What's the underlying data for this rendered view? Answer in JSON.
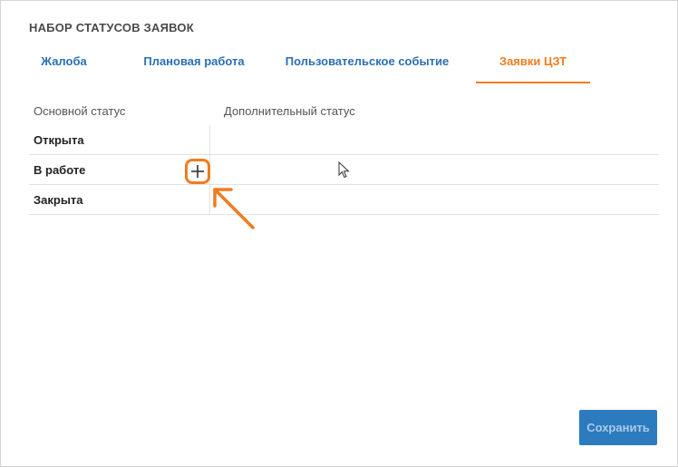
{
  "dialog": {
    "title": "НАБОР СТАТУСОВ ЗАЯВОК"
  },
  "tabs": [
    {
      "label": "Жалоба",
      "active": false
    },
    {
      "label": "Плановая работа",
      "active": false
    },
    {
      "label": "Пользовательское событие",
      "active": false
    },
    {
      "label": "Заявки ЦЗТ",
      "active": true
    }
  ],
  "table": {
    "headers": {
      "main_status": "Основной статус",
      "extra_status": "Дополнительный статус"
    },
    "rows": [
      {
        "main": "Открыта",
        "extra": ""
      },
      {
        "main": "В работе",
        "extra": ""
      },
      {
        "main": "Закрыта",
        "extra": ""
      }
    ]
  },
  "icons": {
    "add": "plus-icon",
    "arrow": "arrow-annotation-icon",
    "cursor": "mouse-cursor-icon"
  },
  "colors": {
    "accent": "#f07c1e",
    "tab_link": "#2a6fb3",
    "primary_button": "#2d7bbf"
  },
  "footer": {
    "save_label": "Сохранить"
  }
}
